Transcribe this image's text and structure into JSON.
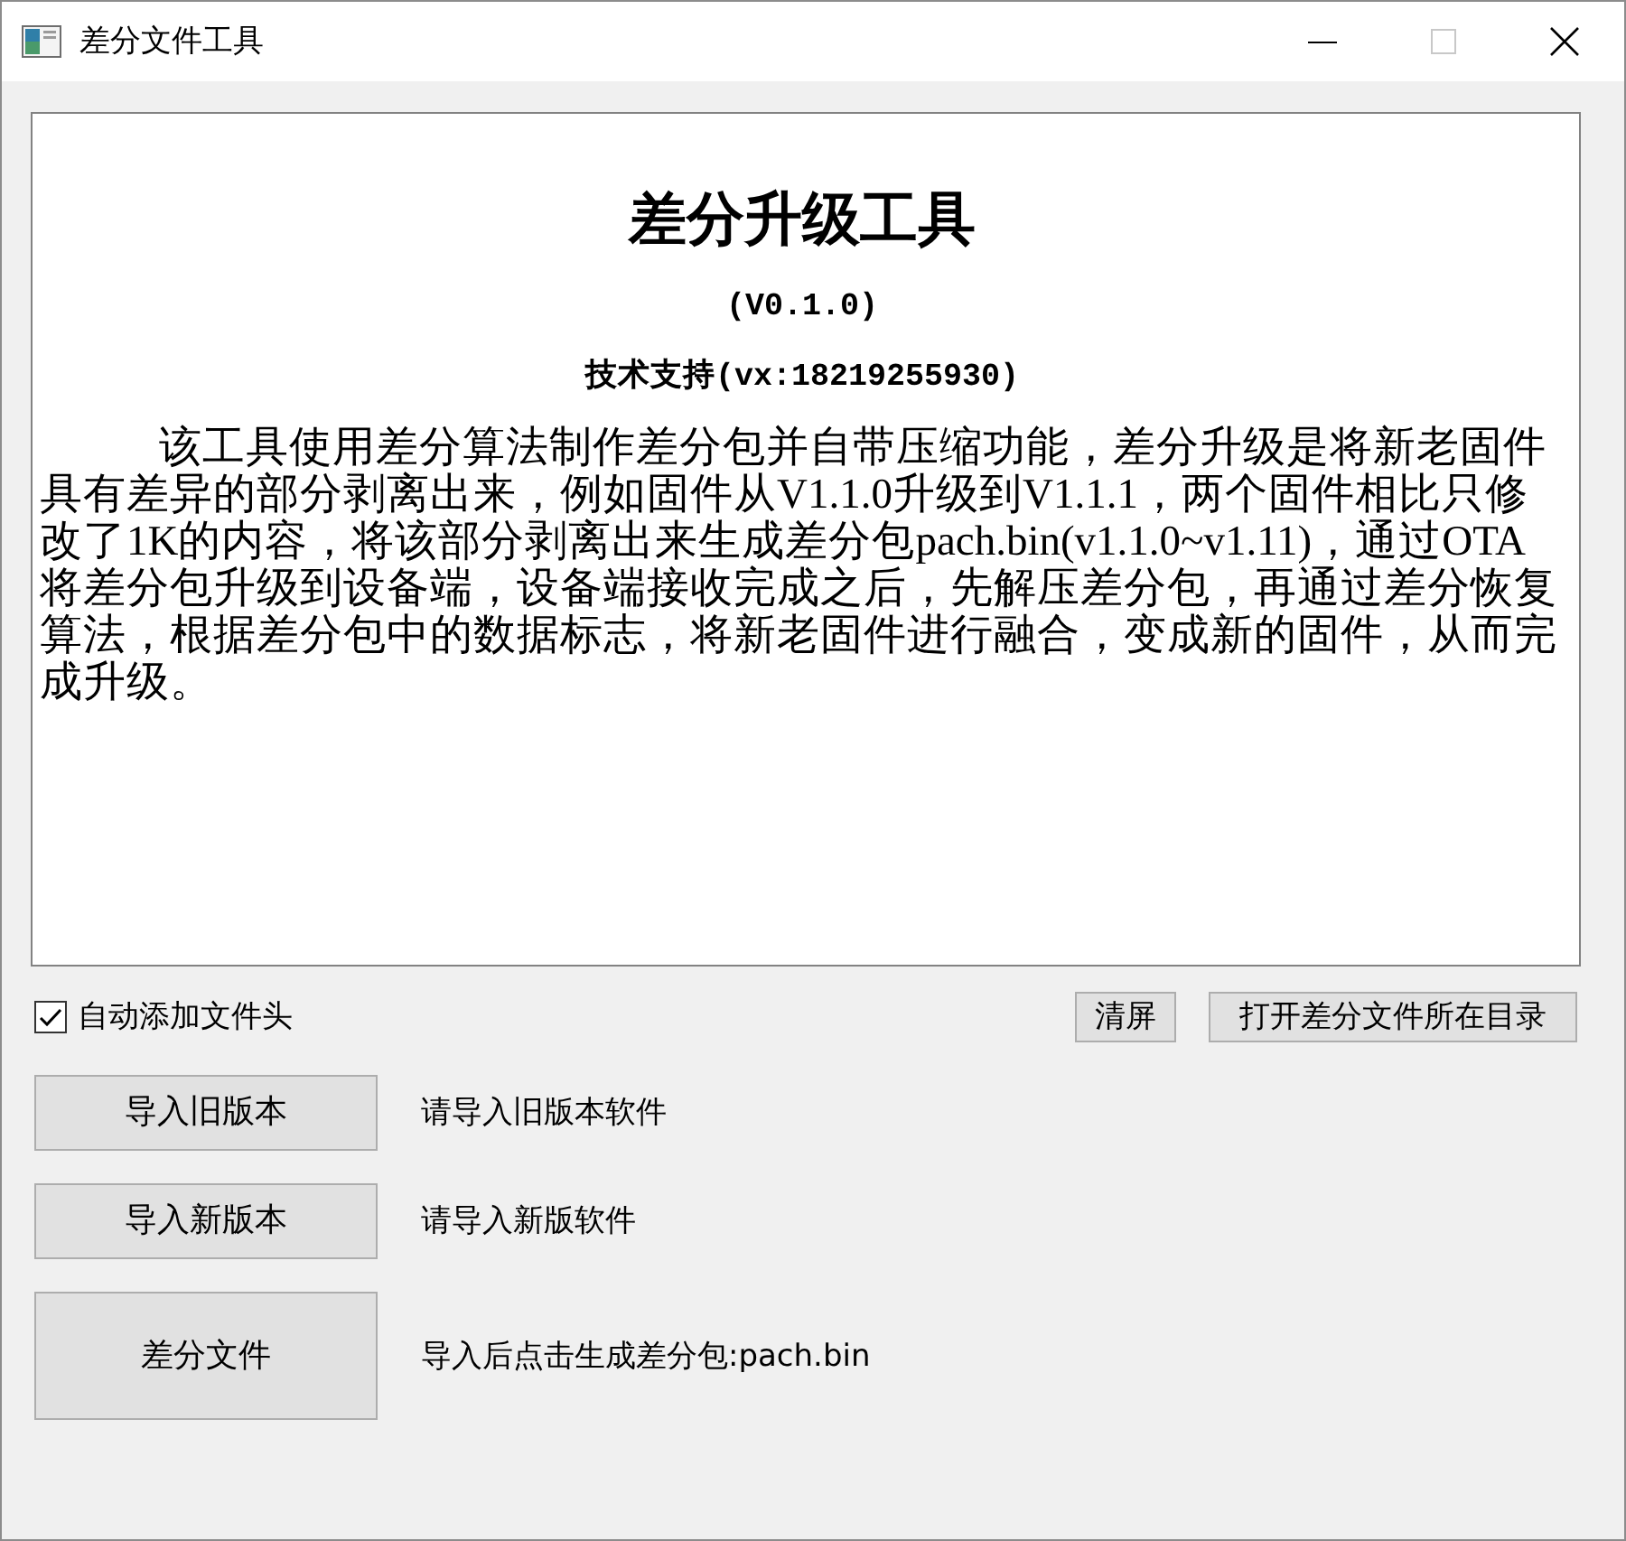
{
  "window": {
    "title": "差分文件工具",
    "caption_buttons": [
      {
        "kind": "minimize",
        "disabled": false
      },
      {
        "kind": "maximize",
        "disabled": true
      },
      {
        "kind": "close",
        "disabled": false
      }
    ]
  },
  "info_panel": {
    "heading": "差分升级工具",
    "version": "(V0.1.0)",
    "support": "技术支持(vx:18219255930)",
    "description": "该工具使用差分算法制作差分包并自带压缩功能，差分升级是将新老固件具有差异的部分剥离出来，例如固件从V1.1.0升级到V1.1.1，两个固件相比只修改了1K的内容，将该部分剥离出来生成差分包pach.bin(v1.1.0~v1.11)，通过OTA将差分包升级到设备端，设备端接收完成之后，先解压差分包，再通过差分恢复算法，根据差分包中的数据标志，将新老固件进行融合，变成新的固件，从而完成升级。"
  },
  "options": {
    "checkbox": {
      "label": "自动添加文件头",
      "checked": true
    },
    "buttons": [
      "清屏",
      "打开差分文件所在目录"
    ]
  },
  "actions": [
    {
      "kind": "import",
      "button": "导入旧版本",
      "hint": "请导入旧版本软件"
    },
    {
      "kind": "import",
      "button": "导入新版本",
      "hint": "请导入新版软件"
    },
    {
      "kind": "generate",
      "button": "差分文件",
      "hint": "导入后点击生成差分包:pach.bin"
    }
  ]
}
